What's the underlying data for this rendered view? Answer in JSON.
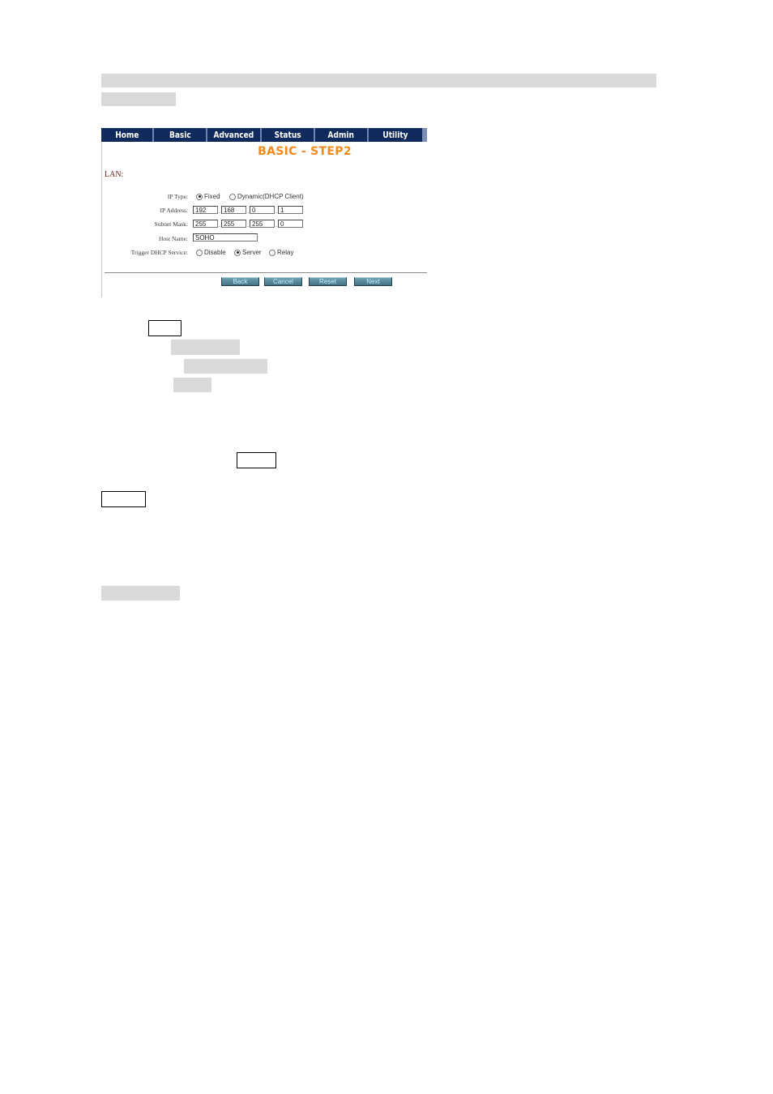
{
  "screenshot": {
    "nav": [
      "Home",
      "Basic",
      "Advanced",
      "Status",
      "Admin",
      "Utility"
    ],
    "title": "BASIC - STEP2",
    "section_label": "LAN:",
    "form": {
      "ip_type": {
        "label": "IP Type:",
        "options": [
          "Fixed",
          "Dynamic(DHCP Client)"
        ],
        "selected": "Fixed"
      },
      "ip_address": {
        "label": "IP Address:",
        "octets": [
          "192",
          "168",
          "0",
          "1"
        ]
      },
      "subnet_mask": {
        "label": "Subnet Mask:",
        "octets": [
          "255",
          "255",
          "255",
          "0"
        ]
      },
      "host_name": {
        "label": "Host Name:",
        "value": "SOHO"
      },
      "dhcp_service": {
        "label": "Trigger DHCP Service:",
        "options": [
          "Disable",
          "Server",
          "Relay"
        ],
        "selected": "Server"
      },
      "separator": "."
    },
    "buttons": {
      "back": "Back",
      "cancel": "Cancel",
      "reset": "Reset",
      "next": "Next"
    },
    "colors": {
      "nav_bg": "#0f2a5c",
      "title": "#f08a1c",
      "section_label": "#7a1f1f",
      "button": "#4f8596"
    }
  }
}
